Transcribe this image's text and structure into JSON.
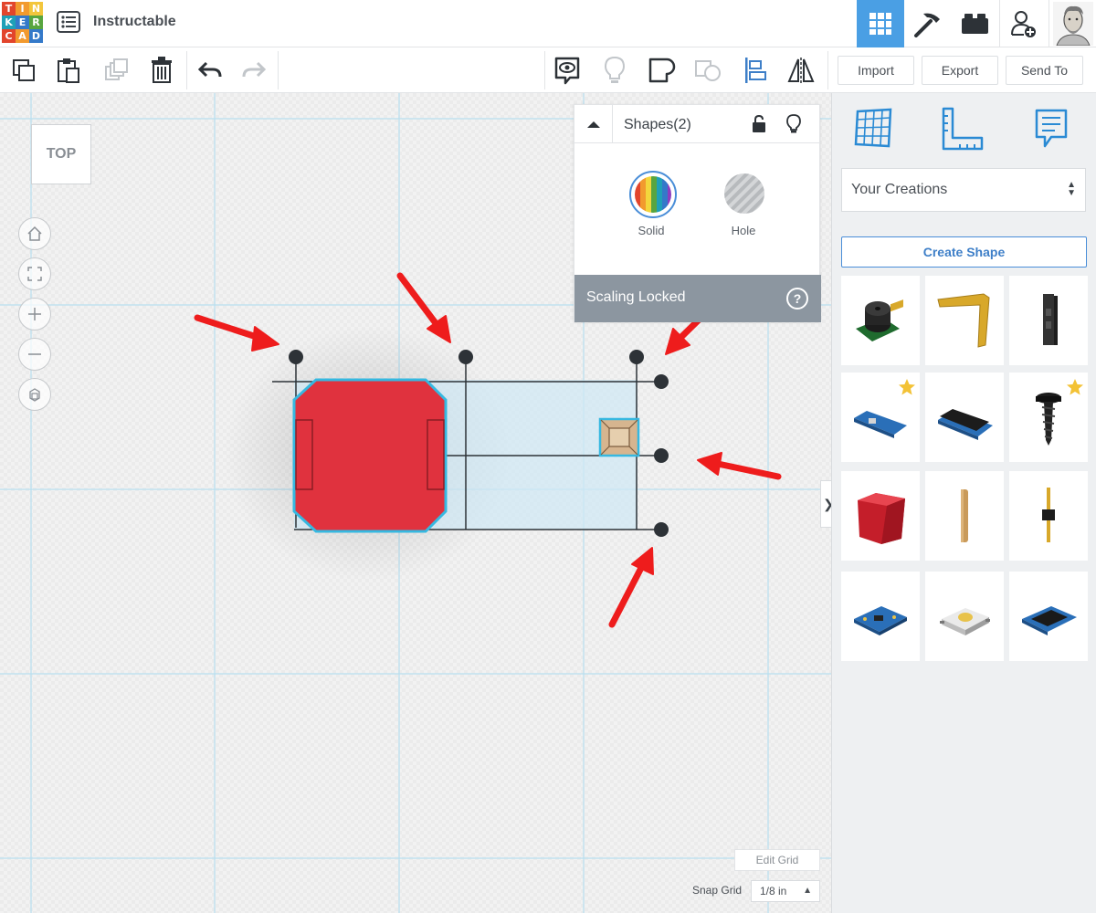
{
  "app": {
    "logo_letters": [
      "T",
      "I",
      "N",
      "K",
      "E",
      "R",
      "C",
      "A",
      "D"
    ],
    "logo_colors": [
      "#e2452c",
      "#f29a2e",
      "#f3c63c",
      "#1fa0b7",
      "#3479c9",
      "#58a53f",
      "#e2452c",
      "#f29a2e",
      "#3479c9"
    ],
    "title": "Instructable"
  },
  "header": {
    "nav": [
      {
        "name": "3d-design-icon",
        "active": true
      },
      {
        "name": "codeblocks-icon",
        "active": false
      },
      {
        "name": "lego-brick-icon",
        "active": false
      },
      {
        "name": "add-user-icon",
        "active": false
      },
      {
        "name": "avatar",
        "active": false
      }
    ]
  },
  "toolbar": {
    "left_icons": [
      "copy-icon",
      "paste-icon",
      "duplicate-icon",
      "delete-icon",
      "undo-icon",
      "redo-icon"
    ],
    "right_icons": [
      "show-all-icon",
      "bulb-icon",
      "group-icon",
      "ungroup-icon",
      "align-icon",
      "mirror-icon"
    ],
    "import_label": "Import",
    "export_label": "Export",
    "sendto_label": "Send To"
  },
  "viewcube": {
    "label": "TOP"
  },
  "view_controls": [
    "home-icon",
    "fit-icon",
    "zoom-in-icon",
    "zoom-out-icon",
    "ortho-icon"
  ],
  "inspector": {
    "title": "Shapes(2)",
    "solid_label": "Solid",
    "hole_label": "Hole",
    "scaling_label": "Scaling Locked",
    "help_label": "?"
  },
  "workplane": {
    "selected_shape_color": "#e0323e",
    "accent": "#36b8e0",
    "edit_grid_label": "Edit Grid",
    "snap_grid_label": "Snap Grid",
    "snap_value": "1/8 in",
    "side_toggle": "❯"
  },
  "sidebar": {
    "tabs": [
      "grid-icon",
      "ruler-icon",
      "notes-icon"
    ],
    "category": "Your Creations",
    "create_label": "Create Shape",
    "shapes": [
      {
        "name": "buzzer-shape",
        "starred": false
      },
      {
        "name": "l-bracket-shape",
        "starred": false
      },
      {
        "name": "connector-shape",
        "starred": false
      },
      {
        "name": "arduino-nano-shape",
        "starred": true
      },
      {
        "name": "arduino-board-shape",
        "starred": false
      },
      {
        "name": "screw-shape",
        "starred": true
      },
      {
        "name": "red-box-shape",
        "starred": false
      },
      {
        "name": "dowel-shape",
        "starred": false
      },
      {
        "name": "header-pin-shape",
        "starred": false
      },
      {
        "name": "sensor-board-shape",
        "starred": false
      },
      {
        "name": "push-button-shape",
        "starred": false
      },
      {
        "name": "oled-display-shape",
        "starred": false
      }
    ]
  }
}
